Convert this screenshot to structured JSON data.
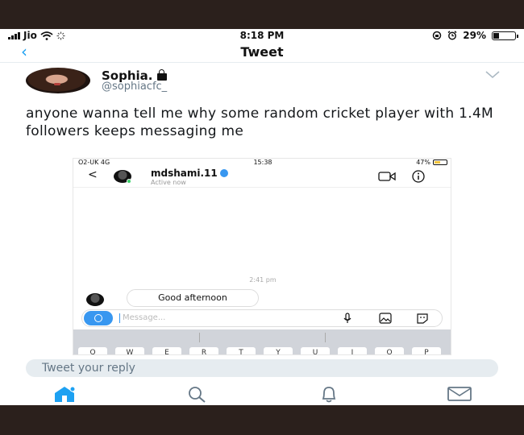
{
  "status_bar": {
    "carrier": "Jio",
    "time": "8:18 PM",
    "battery": "29%",
    "battery_level": 0.29
  },
  "nav": {
    "back_icon": "chevron-left-icon",
    "title": "Tweet"
  },
  "tweet": {
    "author_name": "Sophia.",
    "author_handle": "@sophiacfc_",
    "text": "anyone wanna tell me why some random cricket player with 1.4M followers keeps messaging me"
  },
  "embedded_screenshot": {
    "carrier": "O2-UK  4G",
    "time": "15:38",
    "battery": "47%",
    "battery_level": 0.47,
    "username": "mdshami.11",
    "active_status": "Active now",
    "timestamp": "2:41 pm",
    "message": "Good afternoon",
    "input_placeholder": "Message...",
    "keyboard_keys": [
      "Q",
      "W",
      "E",
      "R",
      "T",
      "Y",
      "U",
      "I",
      "O",
      "P"
    ]
  },
  "reply": {
    "placeholder": "Tweet your reply"
  },
  "tab_bar": {
    "items": [
      "home-icon",
      "search-icon",
      "notifications-icon",
      "messages-icon"
    ],
    "accent": "#1da1f2"
  }
}
